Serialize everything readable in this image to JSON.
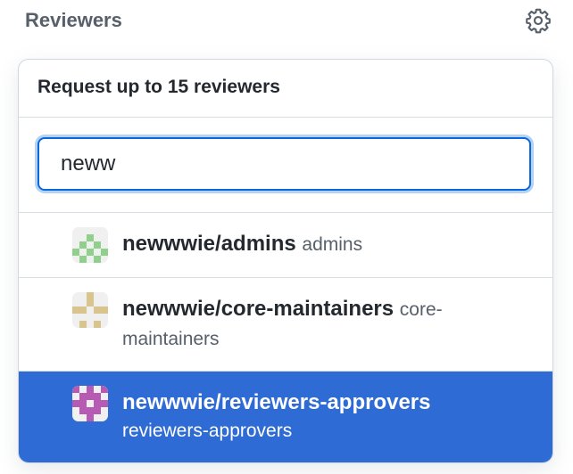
{
  "sidebar_section": {
    "title": "Reviewers"
  },
  "panel": {
    "header": "Request up to 15 reviewers",
    "filter_value": "neww"
  },
  "results": [
    {
      "name": "newwwie/admins",
      "description": "admins",
      "avatar_color": "#8fd18a",
      "selected": false
    },
    {
      "name": "newwwie/core-maintainers",
      "description": "core-maintainers",
      "avatar_color": "#d9c48e",
      "selected": false
    },
    {
      "name": "newwwie/reviewers-approvers",
      "description": "reviewers-approvers",
      "avatar_color": "#b65ab4",
      "selected": true
    }
  ],
  "colors": {
    "accent": "#0969da",
    "selected_bg": "#2f6bd4"
  }
}
